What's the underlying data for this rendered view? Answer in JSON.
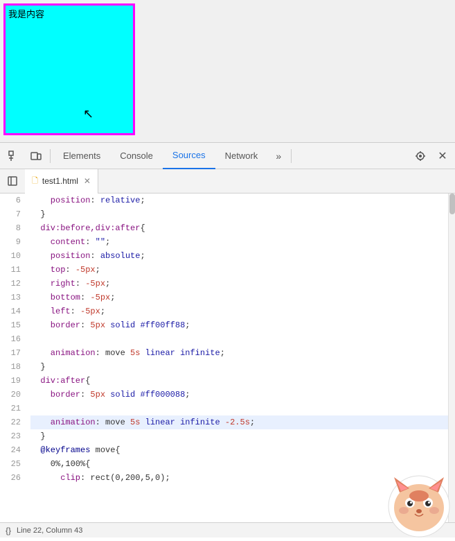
{
  "preview": {
    "chinese_text": "我是内容",
    "cursor": "↖"
  },
  "devtools": {
    "tabs": [
      {
        "label": "Elements",
        "active": false
      },
      {
        "label": "Console",
        "active": false
      },
      {
        "label": "Sources",
        "active": true
      },
      {
        "label": "Network",
        "active": false
      }
    ],
    "more_label": "»",
    "file_tab": {
      "name": "test1.html",
      "icon": "📄"
    },
    "code": {
      "lines": [
        {
          "num": 6,
          "content": [
            {
              "t": "    position: relative;",
              "c": ""
            }
          ]
        },
        {
          "num": 7,
          "content": [
            {
              "t": "  }",
              "c": "punc"
            }
          ]
        },
        {
          "num": 8,
          "content": [
            {
              "t": "  div:before,div:after{",
              "c": "selector"
            }
          ]
        },
        {
          "num": 9,
          "content": [
            {
              "t": "    content: \"\";",
              "c": "prop-str"
            }
          ]
        },
        {
          "num": 10,
          "content": [
            {
              "t": "    position: absolute;",
              "c": ""
            }
          ]
        },
        {
          "num": 11,
          "content": [
            {
              "t": "    top: -5px;",
              "c": ""
            }
          ]
        },
        {
          "num": 12,
          "content": [
            {
              "t": "    right: -5px;",
              "c": ""
            }
          ]
        },
        {
          "num": 13,
          "content": [
            {
              "t": "    bottom: -5px;",
              "c": ""
            }
          ]
        },
        {
          "num": 14,
          "content": [
            {
              "t": "    left: -5px;",
              "c": ""
            }
          ]
        },
        {
          "num": 15,
          "content": [
            {
              "t": "    border: 5px solid #ff00ff88;",
              "c": ""
            }
          ]
        },
        {
          "num": 16,
          "content": [
            {
              "t": "",
              "c": ""
            }
          ]
        },
        {
          "num": 17,
          "content": [
            {
              "t": "    animation: move 5s linear infinite;",
              "c": ""
            }
          ]
        },
        {
          "num": 18,
          "content": [
            {
              "t": "  }",
              "c": "punc"
            }
          ]
        },
        {
          "num": 19,
          "content": [
            {
              "t": "  div:after{",
              "c": "selector"
            }
          ]
        },
        {
          "num": 20,
          "content": [
            {
              "t": "    border: 5px solid #ff000088;",
              "c": ""
            }
          ]
        },
        {
          "num": 21,
          "content": [
            {
              "t": "",
              "c": ""
            }
          ]
        },
        {
          "num": 22,
          "content": [
            {
              "t": "    animation: move 5s linear infinite -2.5s;",
              "c": "",
              "highlighted": true
            }
          ]
        },
        {
          "num": 23,
          "content": [
            {
              "t": "  }",
              "c": "punc"
            }
          ]
        },
        {
          "num": 24,
          "content": [
            {
              "t": "  @keyframes move{",
              "c": "at-rule"
            }
          ]
        },
        {
          "num": 25,
          "content": [
            {
              "t": "    0%,100%{",
              "c": ""
            }
          ]
        },
        {
          "num": 26,
          "content": [
            {
              "t": "      clip: rect(0,200,5,0);",
              "c": ""
            }
          ]
        }
      ]
    },
    "status": {
      "icon": "{}",
      "text": "Line 22, Column 43"
    }
  }
}
